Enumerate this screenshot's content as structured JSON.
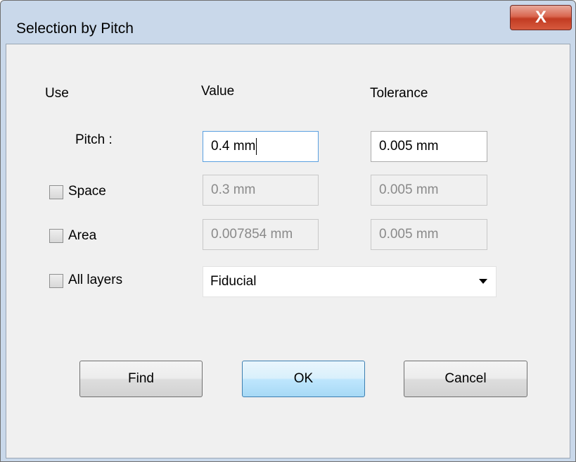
{
  "window": {
    "title": "Selection by Pitch",
    "close_glyph": "X"
  },
  "headers": {
    "use": "Use",
    "value": "Value",
    "tolerance": "Tolerance"
  },
  "rows": {
    "pitch": {
      "label": "Pitch :",
      "value": "0.4 mm",
      "tolerance": "0.005 mm"
    },
    "space": {
      "label": "Space",
      "value": "0.3 mm",
      "tolerance": "0.005 mm",
      "checked": false
    },
    "area": {
      "label": "Area",
      "value": "0.007854 mm",
      "tolerance": "0.005 mm",
      "checked": false
    },
    "all_layers": {
      "label": "All layers",
      "checked": false,
      "selected": "Fiducial"
    }
  },
  "buttons": {
    "find": "Find",
    "ok": "OK",
    "cancel": "Cancel"
  }
}
